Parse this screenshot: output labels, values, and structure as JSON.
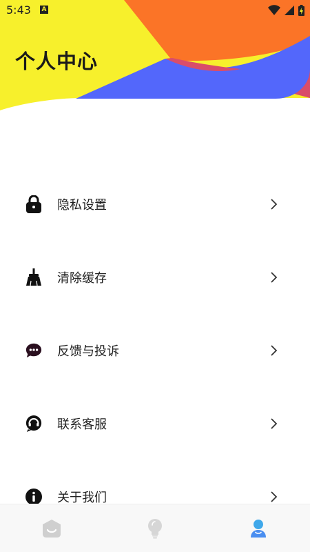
{
  "status_bar": {
    "time": "5:43",
    "notification_letter": "A",
    "icons": [
      "wifi-icon",
      "cellular-signal-icon",
      "battery-charging-icon"
    ]
  },
  "header": {
    "title": "个人中心",
    "colors": {
      "yellow": "#f7f02c",
      "orange": "#fb7427",
      "pink": "#d94d6a",
      "blue": "#5367fb"
    }
  },
  "menu": {
    "items": [
      {
        "label": "隐私设置",
        "icon": "lock-icon"
      },
      {
        "label": "清除缓存",
        "icon": "broom-icon"
      },
      {
        "label": "反馈与投诉",
        "icon": "chat-bubble-icon"
      },
      {
        "label": "联系客服",
        "icon": "customer-service-icon"
      },
      {
        "label": "关于我们",
        "icon": "info-icon"
      }
    ],
    "chevron_icon": "chevron-right-icon"
  },
  "tabbar": {
    "tabs": [
      {
        "icon": "home-face-icon",
        "active": false
      },
      {
        "icon": "lightbulb-icon",
        "active": false
      },
      {
        "icon": "user-icon",
        "active": true
      }
    ],
    "colors": {
      "inactive": "#cfcfcf",
      "active": "#4a9df0"
    }
  }
}
